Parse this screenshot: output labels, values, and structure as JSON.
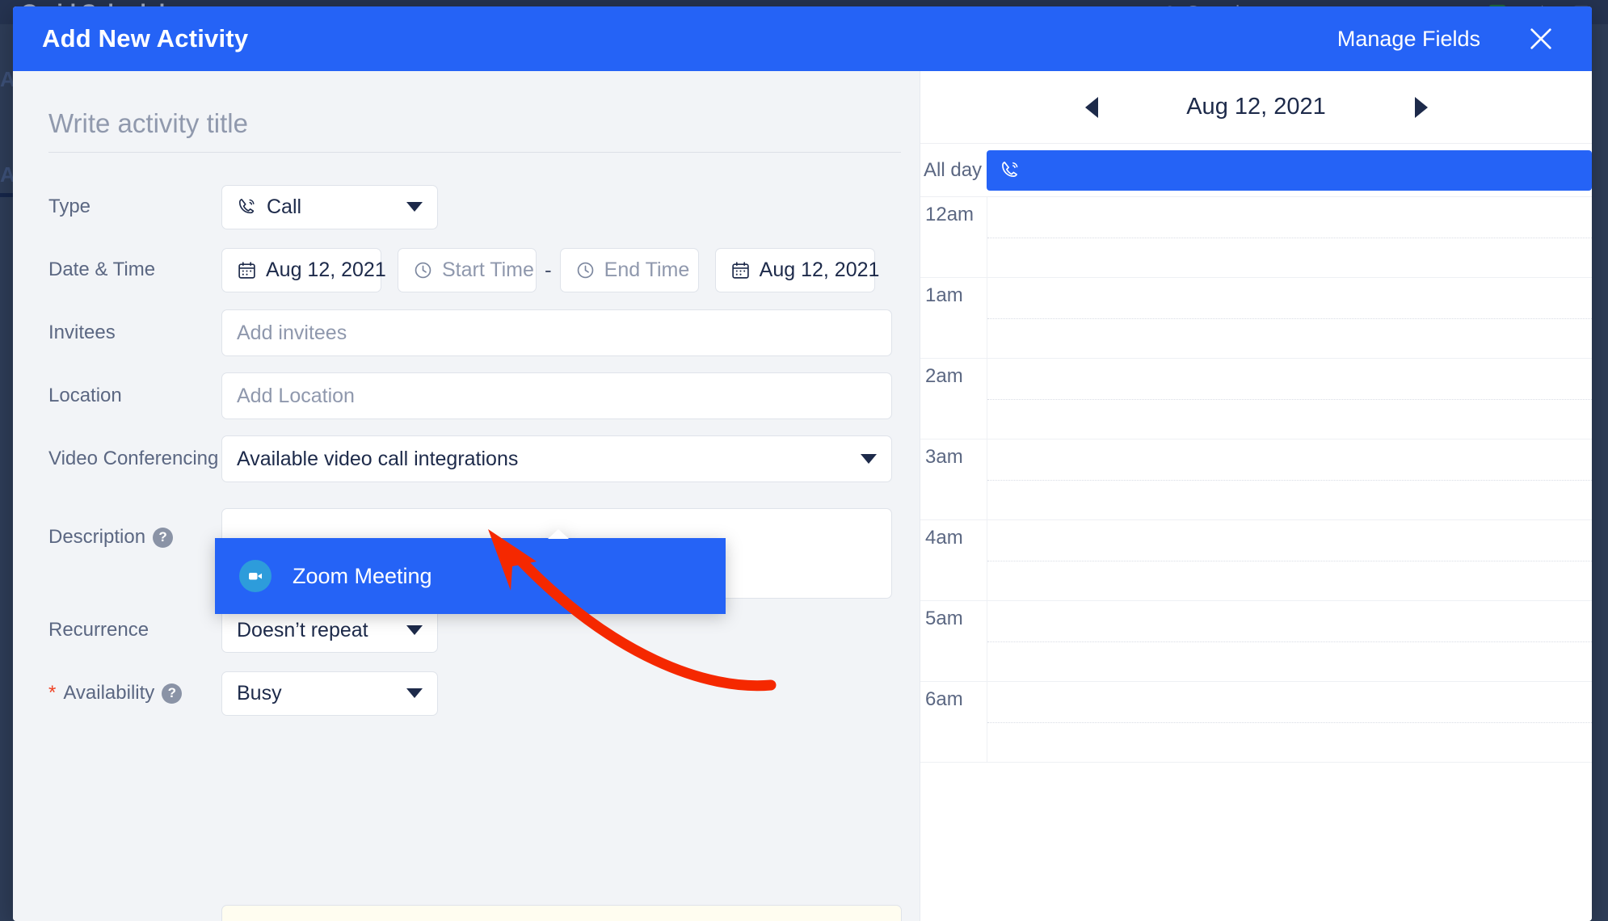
{
  "backdrop": {
    "app_title": "Gmid Scheduler",
    "search_placeholder": "Search",
    "ghost_line_1": "Ac",
    "ghost_line_2": "A"
  },
  "modal": {
    "title": "Add New Activity",
    "manage_fields_label": "Manage Fields",
    "close_icon": "close-icon"
  },
  "form": {
    "title_placeholder": "Write activity title",
    "title_value": "",
    "type": {
      "label": "Type",
      "value": "Call",
      "icon": "phone-call-icon"
    },
    "datetime": {
      "label": "Date & Time",
      "start_date": "Aug 12, 2021",
      "start_time_placeholder": "Start Time",
      "start_time_value": "",
      "separator": "-",
      "end_time_placeholder": "End Time",
      "end_time_value": "",
      "end_date": "Aug 12, 2021",
      "date_icon": "calendar-icon",
      "time_icon": "clock-icon"
    },
    "invitees": {
      "label": "Invitees",
      "placeholder": "Add invitees",
      "value": ""
    },
    "location": {
      "label": "Location",
      "placeholder": "Add Location",
      "value": ""
    },
    "video_conferencing": {
      "label": "Video Conferencing",
      "value": "Available video call integrations",
      "options": [
        {
          "label": "Zoom Meeting",
          "icon": "zoom-video-icon",
          "selected": true
        }
      ]
    },
    "description": {
      "label": "Description",
      "help_icon": "help-icon",
      "value": ""
    },
    "recurrence": {
      "label": "Recurrence",
      "value": "Doesn’t repeat"
    },
    "availability": {
      "label": "Availability",
      "required_marker": "*",
      "help_icon": "help-icon",
      "value": "Busy"
    }
  },
  "calendar": {
    "prev_icon": "chevron-left-icon",
    "next_icon": "chevron-right-icon",
    "date": "Aug 12, 2021",
    "all_day_label": "All day",
    "all_day_event_icon": "phone-call-icon",
    "hours": [
      "12am",
      "1am",
      "2am",
      "3am",
      "4am",
      "5am",
      "6am"
    ]
  },
  "colors": {
    "accent_blue": "#2563f6",
    "backdrop_navy": "#2e3d58",
    "annotation_red": "#f52800",
    "zoom_logo_blue": "#2d9cdb",
    "required_red": "#ef4123"
  },
  "annotation": {
    "arrow_icon": "curved-arrow-annotation",
    "points_to": "video-conferencing-select"
  }
}
